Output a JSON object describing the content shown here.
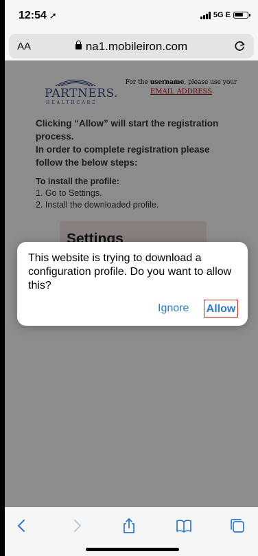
{
  "status": {
    "time": "12:54",
    "network": "5G E"
  },
  "browser": {
    "aa_label": "AA",
    "url": "na1.mobileiron.com"
  },
  "page": {
    "logo_name": "PARTNERS.",
    "logo_sub": "HEALTHCARE",
    "note_pre": "For the ",
    "note_bold": "username",
    "note_post": ", please use your",
    "note_email": "EMAIL ADDRESS",
    "para_bold": "Clicking “Allow” will start the registration process.\nIn order to complete registration please follow the below steps:",
    "install_title": "To install the profile:",
    "steps": [
      "1. Go to Settings.",
      "2. Install the downloaded profile."
    ],
    "settings_label": "Settings"
  },
  "dialog": {
    "message": "This website is trying to download a configuration profile. Do you want to allow this?",
    "ignore_label": "Ignore",
    "allow_label": "Allow"
  },
  "colors": {
    "accent": "#2f79c8",
    "highlight_border": "#d2222a"
  }
}
